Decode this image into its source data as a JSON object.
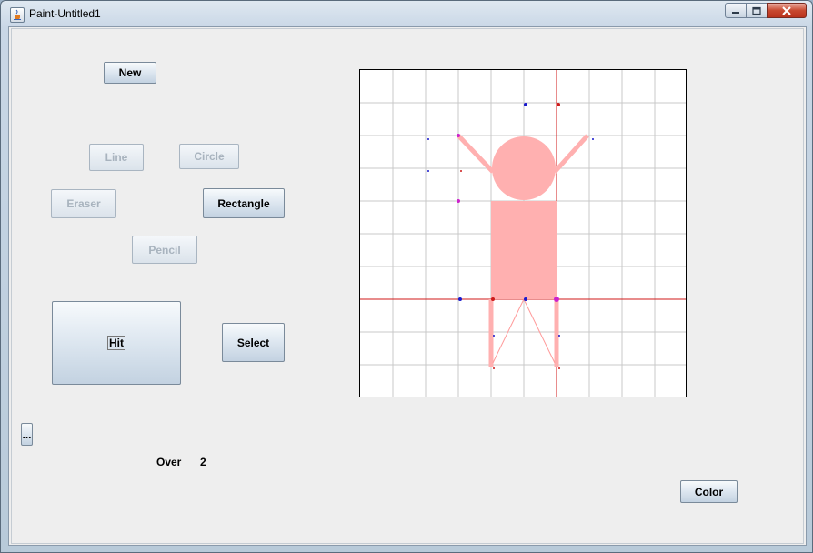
{
  "window": {
    "title": "Paint-Untitled1"
  },
  "buttons": {
    "new": "New",
    "line": "Line",
    "circle": "Circle",
    "eraser": "Eraser",
    "rectangle": "Rectangle",
    "pencil": "Pencil",
    "hit": "Hit",
    "select": "Select",
    "more": "...",
    "color": "Color"
  },
  "status": {
    "over_label": "Over",
    "over_value": "2"
  },
  "canvas": {
    "background": "#ffffff",
    "grid_color": "#c8c8c8",
    "crosshair_color": "#d01818",
    "figure_color": "#ffb0b0",
    "marker_colors": [
      "#1a1acc",
      "#cc1a1a",
      "#cc22cc"
    ]
  },
  "icons": {
    "app": "java-cup-icon",
    "minimize": "minimize-icon",
    "maximize": "maximize-icon",
    "close": "close-icon"
  }
}
